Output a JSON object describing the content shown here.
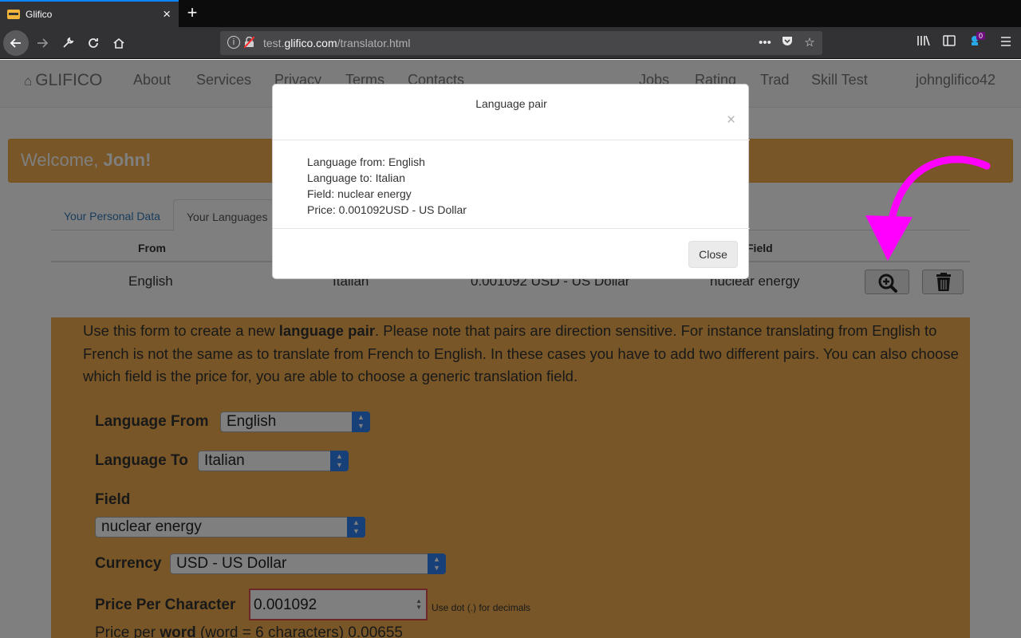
{
  "browser": {
    "tab_title": "Glifico",
    "tab_close": "×",
    "new_tab": "+",
    "url_host_prefix": "test.",
    "url_host": "glifico.com",
    "url_path": "/translator.html",
    "notification_count": "0"
  },
  "site_nav": {
    "brand": "GLIFICO",
    "left_items": [
      "About",
      "Services",
      "Privacy",
      "Terms",
      "Contacts"
    ],
    "right_items": [
      "Jobs",
      "Rating",
      "Trad",
      "Skill Test"
    ],
    "user": "johnglifico42"
  },
  "welcome": {
    "prefix": "Welcome, ",
    "name": "John!"
  },
  "tabs": [
    "Your Personal Data",
    "Your Languages"
  ],
  "table": {
    "headers": [
      "From",
      "Field"
    ],
    "row": {
      "from": "English",
      "to": "Italian",
      "price": "0.001092 USD - US Dollar",
      "field": "nuclear energy"
    }
  },
  "form": {
    "intro_a": "Use this form to create a new ",
    "intro_bold": "language pair",
    "intro_b": ". Please note that pairs are direction sensitive. For instance translating from English to French is not the same as to translate from French to English. In these cases you have to add two different pairs. You can also choose which field is the price for, you are able to choose a generic translation field.",
    "language_from_label": "Language From",
    "language_from_value": "English",
    "language_to_label": "Language To",
    "language_to_value": "Italian",
    "field_label": "Field",
    "field_value": "nuclear energy",
    "currency_label": "Currency",
    "currency_value": "USD - US Dollar",
    "price_label": "Price Per Character",
    "price_value": "0.001092",
    "price_hint": "Use dot (.) for decimals",
    "ppw_a": "Price per ",
    "ppw_bold": "word",
    "ppw_b": " (word = 6 characters) 0.00655"
  },
  "modal": {
    "title": "Language pair",
    "close_x": "×",
    "lines": [
      "Language from: English",
      "Language to: Italian",
      "Field: nuclear energy",
      "Price: 0.001092USD - US Dollar"
    ],
    "close_button": "Close"
  },
  "colors": {
    "accent_orange": "#f0ad4e",
    "annotation_arrow": "#ff00ff",
    "link_blue": "#337ab7"
  }
}
